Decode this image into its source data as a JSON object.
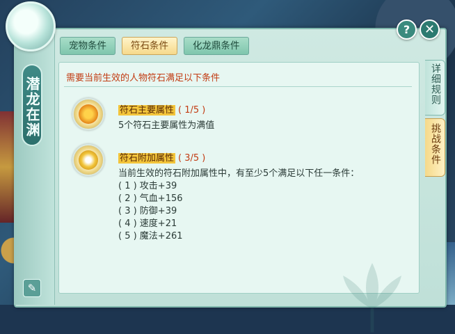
{
  "sidebar": {
    "title": "潜龙在渊"
  },
  "tabs": [
    {
      "label": "宠物条件"
    },
    {
      "label": "符石条件"
    },
    {
      "label": "化龙鼎条件"
    }
  ],
  "top_buttons": {
    "help": "?",
    "close": "✕"
  },
  "right_tabs": [
    {
      "label": "详细规则"
    },
    {
      "label": "挑战条件"
    }
  ],
  "header": "需要当前生效的人物符石满足以下条件",
  "conditions": [
    {
      "title": "符石主要属性",
      "count": "( 1/5 )",
      "lines": [
        "5个符石主要属性为满值"
      ]
    },
    {
      "title": "符石附加属性",
      "count": "( 3/5 )",
      "lines": [
        "当前生效的符石附加属性中，有至少5个满足以下任一条件：",
        "( 1 ) 攻击+39",
        "( 2 ) 气血+156",
        "( 3 ) 防御+39",
        "( 4 ) 速度+21",
        "( 5 ) 魔法+261"
      ]
    }
  ],
  "colors": {
    "accent_red": "#c23b12",
    "highlight_yellow": "#f3c53b",
    "panel": "#cfe9e2"
  }
}
